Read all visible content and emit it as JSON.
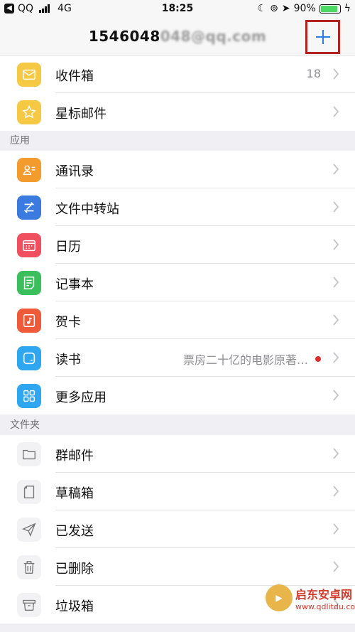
{
  "status_bar": {
    "carrier": "QQ",
    "network": "4G",
    "time": "18:25",
    "battery": "90%",
    "battery_level": 0.9
  },
  "nav": {
    "title_visible": "1546048",
    "title_obscured": "048@qq.com"
  },
  "mail_items": [
    {
      "label": "收件箱",
      "count": "18",
      "icon": "envelope-icon",
      "color": "#f6c944"
    },
    {
      "label": "星标邮件",
      "icon": "star-icon",
      "color": "#f6c944"
    }
  ],
  "sections": {
    "apps": "应用",
    "folders": "文件夹"
  },
  "app_items": [
    {
      "label": "通讯录",
      "icon": "contacts-icon",
      "color": "#f49b2e"
    },
    {
      "label": "文件中转站",
      "icon": "transfer-icon",
      "color": "#3b7be0"
    },
    {
      "label": "日历",
      "icon": "calendar-icon",
      "color": "#ef4f5e"
    },
    {
      "label": "记事本",
      "icon": "notes-icon",
      "color": "#3bbf5c"
    },
    {
      "label": "贺卡",
      "icon": "greeting-card-icon",
      "color": "#ef5a3b"
    },
    {
      "label": "读书",
      "detail": "票房二十亿的电影原著…",
      "icon": "book-icon",
      "color": "#2fa6f0"
    },
    {
      "label": "更多应用",
      "icon": "grid-icon",
      "color": "#2fa6f0"
    }
  ],
  "folder_items": [
    {
      "label": "群邮件",
      "icon": "folder-icon"
    },
    {
      "label": "草稿箱",
      "icon": "draft-icon"
    },
    {
      "label": "已发送",
      "icon": "send-icon"
    },
    {
      "label": "已删除",
      "icon": "trash-icon"
    },
    {
      "label": "垃圾箱",
      "icon": "spam-icon"
    }
  ],
  "watermark": {
    "title": "启东安卓网",
    "url": "www.qdlitdu.com"
  }
}
